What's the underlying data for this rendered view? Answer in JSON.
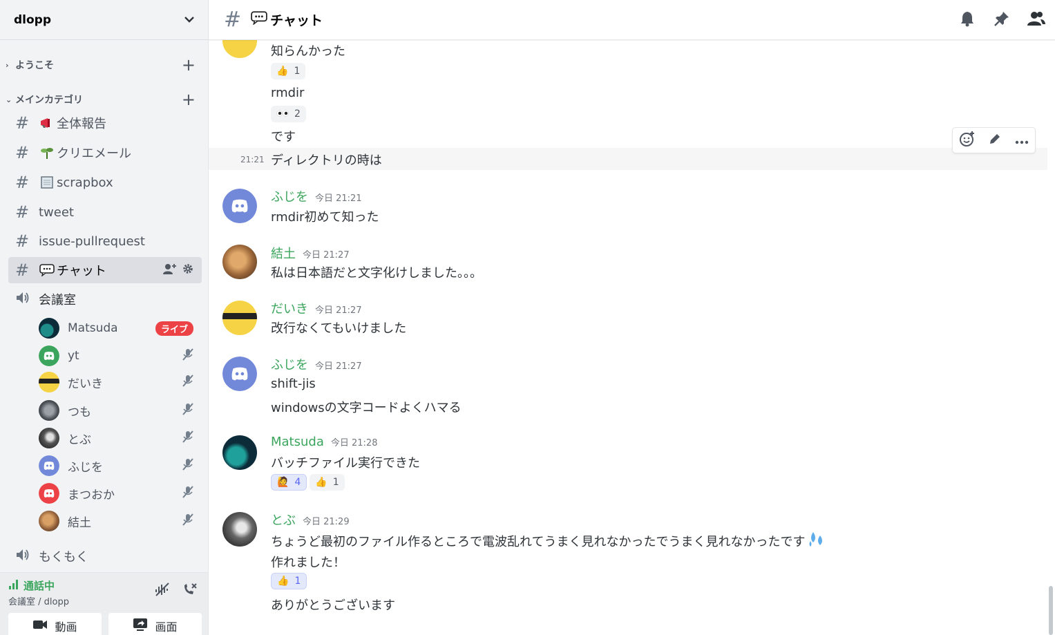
{
  "guild": {
    "name": "dlopp"
  },
  "categories": {
    "welcome": "ようこそ",
    "main": "メインカテゴリ"
  },
  "channels": [
    {
      "label": "全体報告",
      "icon": "megaphone"
    },
    {
      "label": "クリエメール",
      "icon": "seedling"
    },
    {
      "label": "scrapbox",
      "icon": "notebook"
    },
    {
      "label": "tweet",
      "icon": ""
    },
    {
      "label": "issue-pullrequest",
      "icon": ""
    },
    {
      "label": "チャット",
      "icon": "speech-balloon"
    }
  ],
  "voice_channel": {
    "name": "会議室"
  },
  "voice_users": [
    {
      "name": "Matsuda",
      "badge": "ライブ"
    },
    {
      "name": "yt"
    },
    {
      "name": "だいき"
    },
    {
      "name": "つも"
    },
    {
      "name": "とぶ"
    },
    {
      "name": "ふじを"
    },
    {
      "name": "まつおか"
    },
    {
      "name": "結土"
    }
  ],
  "voice_channel2": {
    "name": "もくもく"
  },
  "voice_panel": {
    "status": "通話中",
    "sub": "会議室 / dlopp",
    "video_label": "動画",
    "screen_label": "画面"
  },
  "header": {
    "channel_title": "チャット"
  },
  "messages": {
    "m0_l1": "知らんかった",
    "m0_l2": "rmdir",
    "m0_l3": "です",
    "m0_l4": "ディレクトリの時は",
    "m0_l4_time": "21:21",
    "m0_r1": "1",
    "m0_r2": "2",
    "m1_author": "ふじを",
    "m1_time": "今日 21:21",
    "m1_l1": "rmdir初めて知った",
    "m2_author": "結土",
    "m2_time": "今日 21:27",
    "m2_l1": "私は日本語だと文字化けしました。。。",
    "m3_author": "だいき",
    "m3_time": "今日 21:27",
    "m3_l1": "改行なくてもいけました",
    "m4_author": "ふじを",
    "m4_time": "今日 21:27",
    "m4_l1": "shift-jis",
    "m4_l2": "windowsの文字コードよくハマる",
    "m5_author": "Matsuda",
    "m5_time": "今日 21:28",
    "m5_l1": "バッチファイル実行できた",
    "m5_r1": "4",
    "m5_r2": "1",
    "m6_author": "とぶ",
    "m6_time": "今日 21:29",
    "m6_l1": "ちょうど最初のファイル作るところで電波乱れてうまく見れなかったでうまく見れなかったです",
    "m6_l2": "作れました！",
    "m6_r1": "1",
    "m6_l3": "ありがとうございます"
  },
  "colors": {
    "online_green": "#3ba55d",
    "blurple": "#5865f2",
    "live_red": "#ed4245"
  }
}
